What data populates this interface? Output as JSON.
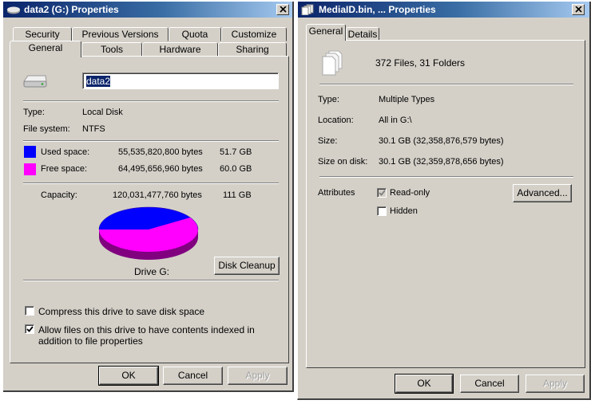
{
  "drive_dialog": {
    "title": "data2 (G:) Properties",
    "tabs_back": [
      "Security",
      "Previous Versions",
      "Quota",
      "Customize"
    ],
    "tabs_front": [
      "General",
      "Tools",
      "Hardware",
      "Sharing"
    ],
    "active_tab": "General",
    "name_value": "data2",
    "type_label": "Type:",
    "type_value": "Local Disk",
    "fs_label": "File system:",
    "fs_value": "NTFS",
    "used": {
      "label": "Used space:",
      "bytes": "55,535,820,800 bytes",
      "size": "51.7 GB",
      "color": "#0000ff"
    },
    "free": {
      "label": "Free space:",
      "bytes": "64,495,656,960 bytes",
      "size": "60.0 GB",
      "color": "#ff00ff"
    },
    "capacity": {
      "label": "Capacity:",
      "bytes": "120,031,477,760 bytes",
      "size": "111 GB"
    },
    "drive_label": "Drive G:",
    "disk_cleanup": "Disk Cleanup",
    "compress_label": "Compress this drive to save disk space",
    "compress_checked": false,
    "index_label": "Allow files on this drive to have contents indexed in addition to file properties",
    "index_checked": true,
    "ok": "OK",
    "cancel": "Cancel",
    "apply": "Apply"
  },
  "file_dialog": {
    "title": "MediaID.bin, ... Properties",
    "tabs": [
      "General",
      "Details"
    ],
    "active_tab": "General",
    "summary": "372 Files, 31 Folders",
    "rows": [
      {
        "label": "Type:",
        "value": "Multiple Types"
      },
      {
        "label": "Location:",
        "value": "All in G:\\"
      },
      {
        "label": "Size:",
        "value": "30.1 GB (32,358,876,579 bytes)"
      },
      {
        "label": "Size on disk:",
        "value": "30.1 GB (32,359,878,656 bytes)"
      }
    ],
    "attributes_label": "Attributes",
    "readonly_label": "Read-only",
    "readonly_state": "indeterminate",
    "hidden_label": "Hidden",
    "hidden_checked": false,
    "advanced": "Advanced...",
    "ok": "OK",
    "cancel": "Cancel",
    "apply": "Apply"
  }
}
